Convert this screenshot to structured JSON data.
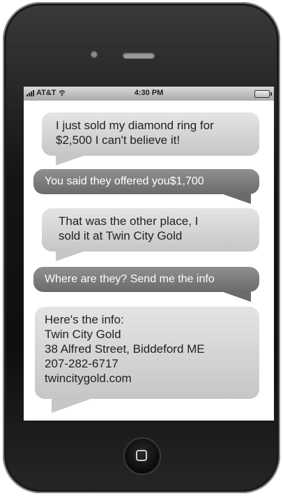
{
  "status_bar": {
    "carrier": "AT&T",
    "time": "4:30 PM",
    "icons": [
      "signal-icon",
      "wifi-icon",
      "battery-icon"
    ]
  },
  "messages": [
    {
      "sender": "other",
      "lines": [
        "I just sold my diamond ring for",
        "$2,500 I can't believe it!"
      ]
    },
    {
      "sender": "me",
      "lines": [
        "You said they offered you$1,700"
      ]
    },
    {
      "sender": "other",
      "lines": [
        "That was the other place, I",
        "sold it at Twin City Gold"
      ]
    },
    {
      "sender": "me",
      "lines": [
        "Where are they? Send me the info"
      ]
    },
    {
      "sender": "other",
      "lines": [
        "Here's the info:",
        "Twin City Gold",
        "38 Alfred Street, Biddeford ME",
        "207-282-6717",
        "twincitygold.com"
      ]
    }
  ],
  "colors": {
    "incoming_bubble": "#c6c6c6",
    "outgoing_bubble": "#6a6a6a",
    "phone_body": "#151515"
  }
}
